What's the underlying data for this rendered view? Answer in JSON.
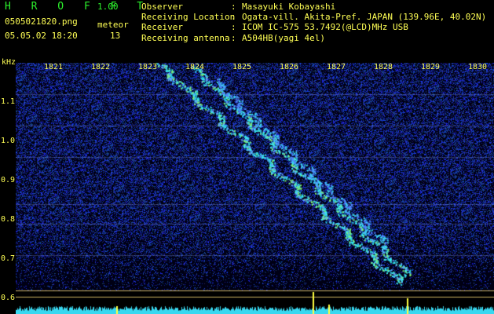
{
  "header": {
    "app_title": "H R O F F T",
    "version": "1.00",
    "filename": "0505021820.png",
    "meteor_label": "meteor",
    "datetime": "05.05.02 18:20",
    "meteor_count": "13"
  },
  "info": [
    {
      "key": "Observer",
      "sep": ":",
      "value": "Masayuki Kobayashi"
    },
    {
      "key": "Receiving Location",
      "sep": ":",
      "value": "Ogata-vill. Akita-Pref. JAPAN (139.96E, 40.02N)"
    },
    {
      "key": "Receiver",
      "sep": ":",
      "value": "ICOM IC-575 53.7492(@LCD)MHz USB"
    },
    {
      "key": "Receiving antenna",
      "sep": ":",
      "value": "A504HB(yagi 4el)"
    }
  ],
  "axis": {
    "y_unit": "kHz",
    "y_ticks": [
      "1.1",
      "1.0",
      "0.9",
      "0.8",
      "0.7",
      "0.6"
    ],
    "x_ticks": [
      "1821",
      "1822",
      "1823",
      "1824",
      "1825",
      "1826",
      "1827",
      "1828",
      "1829",
      "1830"
    ]
  },
  "colors": {
    "header_green": "#2cf02c",
    "label_yellow": "#ffff55",
    "background": "#000000",
    "noise_blue": "#1a2cd8",
    "signal_cyan": "#3cf0f0",
    "signal_green": "#7cf07c"
  }
}
